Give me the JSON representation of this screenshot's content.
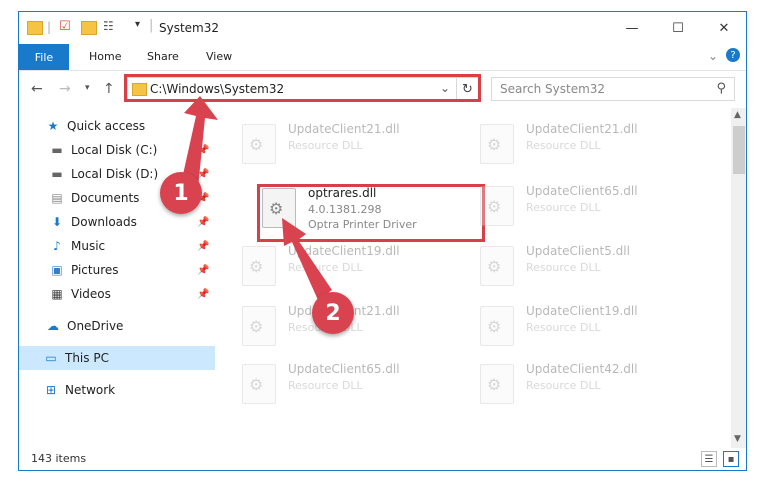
{
  "window": {
    "title": "System32"
  },
  "ribbon": {
    "file": "File",
    "home": "Home",
    "share": "Share",
    "view": "View"
  },
  "address": {
    "path": "C:\\Windows\\System32"
  },
  "search": {
    "placeholder": "Search System32"
  },
  "nav": {
    "quick_access": "Quick access",
    "items": [
      "Local Disk (C:)",
      "Local Disk (D:)",
      "Documents",
      "Downloads",
      "Music",
      "Pictures",
      "Videos"
    ],
    "onedrive": "OneDrive",
    "this_pc": "This PC",
    "network": "Network"
  },
  "files": {
    "left": [
      {
        "name": "UpdateClient21.dll",
        "sub1": "Resource DLL"
      },
      {
        "name": "optrares.dll",
        "sub1": "4.0.1381.298",
        "sub2": "Optra Printer Driver"
      },
      {
        "name": "UpdateClient19.dll",
        "sub1": "Resource DLL"
      },
      {
        "name": "UpdateClient21.dll",
        "sub1": "Resource DLL"
      },
      {
        "name": "UpdateClient65.dll",
        "sub1": "Resource DLL"
      }
    ],
    "right": [
      {
        "name": "UpdateClient21.dll",
        "sub1": "Resource DLL"
      },
      {
        "name": "UpdateClient65.dll",
        "sub1": "Resource DLL"
      },
      {
        "name": "UpdateClient5.dll",
        "sub1": "Resource DLL"
      },
      {
        "name": "UpdateClient19.dll",
        "sub1": "Resource DLL"
      },
      {
        "name": "UpdateClient42.dll",
        "sub1": "Resource DLL"
      }
    ]
  },
  "status": {
    "count": "143 items"
  },
  "markers": {
    "one": "1",
    "two": "2"
  },
  "colors": {
    "accent": "#1979ca",
    "highlight": "#d64046",
    "selected": "#cce8ff"
  }
}
